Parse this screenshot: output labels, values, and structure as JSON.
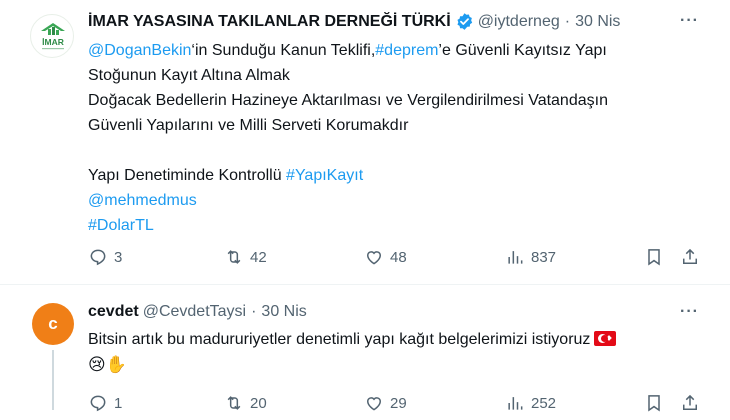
{
  "main_tweet": {
    "avatar_text": "İMAR",
    "name": "İMAR YASASINA TAKILANLAR DERNEĞİ TÜRKİ",
    "handle": "@iytderneg",
    "separator": "·",
    "date": "30 Nis",
    "more": "···",
    "lines": {
      "l1_mention": "@DoganBekin",
      "l1_text_a": "‘in Sunduğu Kanun Teklifi,",
      "l1_hashtag": "#deprem",
      "l1_text_b": "’e Güvenli Kayıtsız Yapı",
      "l2": "Stoğunun Kayıt Altına Almak",
      "l3": "Doğacak Bedellerin Hazineye Aktarılması ve Vergilendirilmesi Vatandaşın",
      "l4": "Güvenli Yapılarını ve Milli Serveti Korumakdır",
      "l5_text": "Yapı Denetiminde Kontrollü ",
      "l5_hashtag": "#YapıKayıt",
      "l6": "@mehmedmus",
      "l7": "#DolarTL"
    },
    "stats": {
      "replies": "3",
      "retweets": "42",
      "likes": "48",
      "views": "837"
    }
  },
  "reply_tweet": {
    "avatar_letter": "c",
    "name": "cevdet",
    "handle": "@CevdetTaysi",
    "separator": "·",
    "date": "30 Nis",
    "more": "···",
    "text": "Bitsin artık bu madururiyetler denetimli yapı kağıt belgelerimizi istiyoruz",
    "emojis": "😢✋",
    "stats": {
      "replies": "1",
      "retweets": "20",
      "likes": "29",
      "views": "252"
    }
  },
  "colors": {
    "link": "#1d9bf0",
    "muted": "#536471",
    "avatar_orange": "#f07f17",
    "verified": "#1d9bf0"
  },
  "icons": [
    "verified-badge-icon",
    "reply-icon",
    "retweet-icon",
    "like-icon",
    "views-icon",
    "bookmark-icon",
    "share-icon",
    "turkey-flag-icon"
  ]
}
